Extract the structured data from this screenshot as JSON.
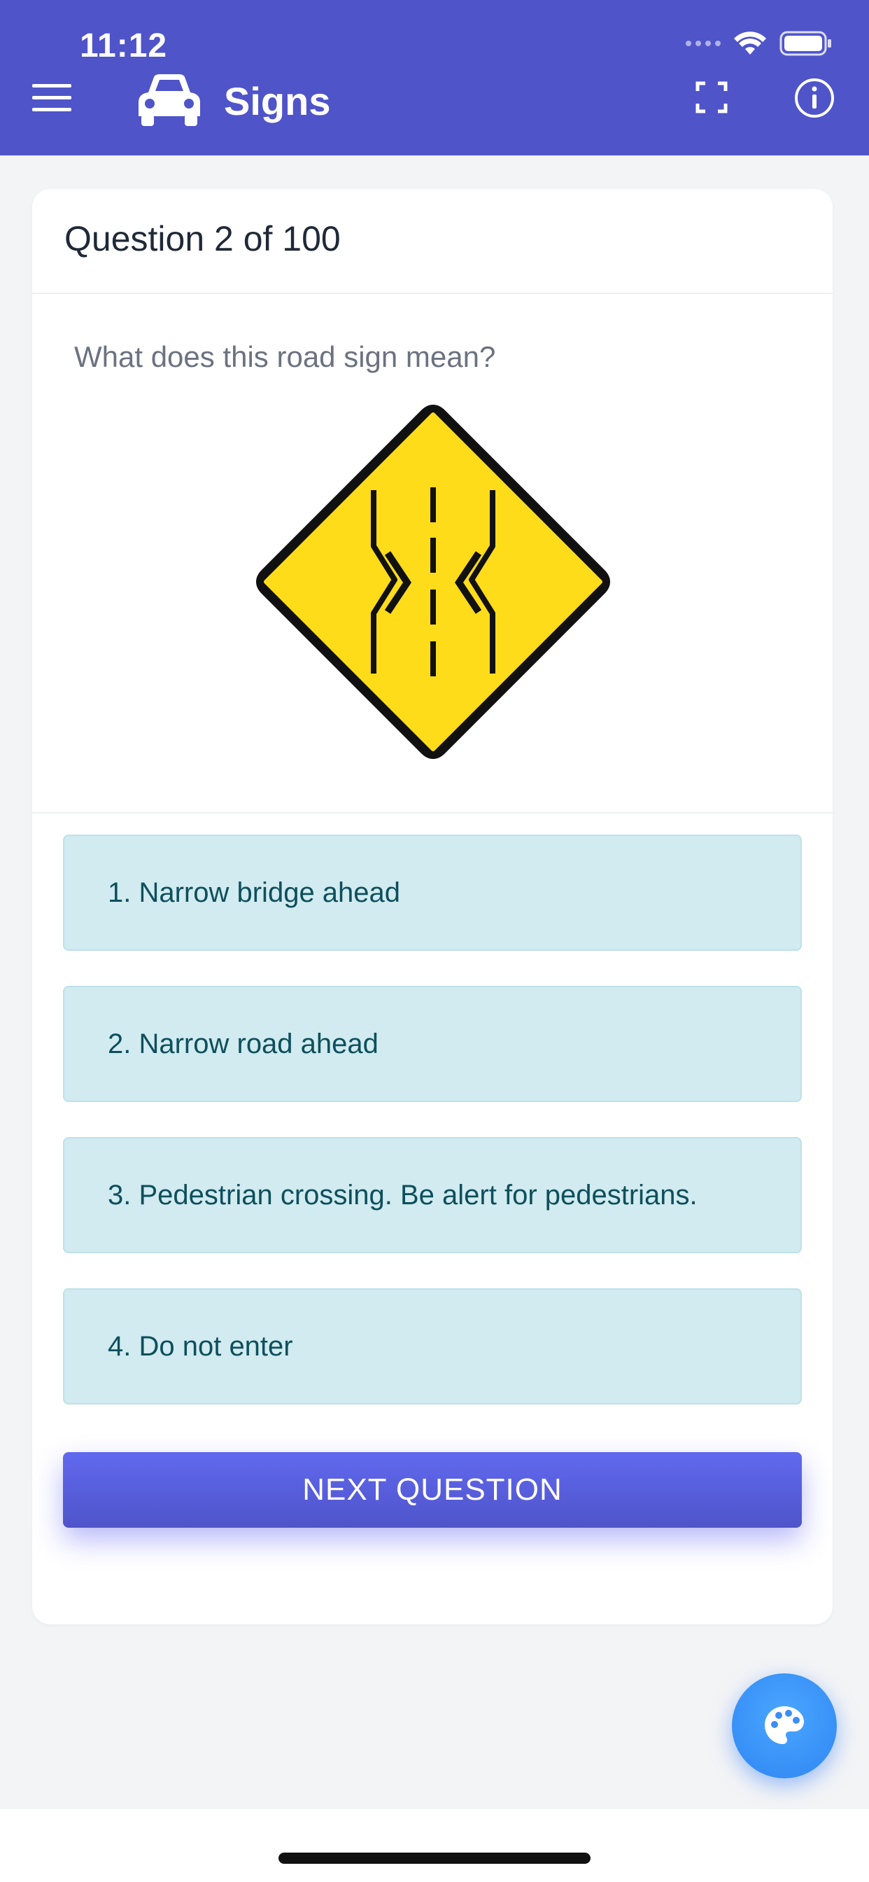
{
  "status_bar": {
    "time": "11:12"
  },
  "header": {
    "title": "Signs",
    "icons": [
      "menu-icon",
      "car-icon",
      "fullscreen-icon",
      "info-icon"
    ]
  },
  "quiz": {
    "question_counter": "Question 2 of 100",
    "question_text": "What does this road sign mean?",
    "sign": "narrow-bridge-sign",
    "answers": [
      "1. Narrow bridge ahead",
      "2. Narrow road ahead",
      "3. Pedestrian crossing. Be alert for pedestrians.",
      "4. Do not enter"
    ],
    "next_label": "NEXT QUESTION"
  },
  "fab": {
    "icon": "palette-icon"
  },
  "colors": {
    "header": "#4f54c9",
    "answer_bg": "#d1ebf0",
    "answer_text": "#0e4f5c",
    "button": "#5b61e8",
    "fab": "#3b8ef5",
    "sign_yellow": "#ffdc1a"
  }
}
